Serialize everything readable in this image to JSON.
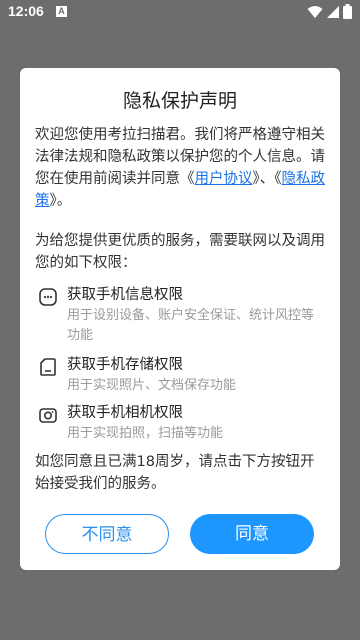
{
  "status_bar": {
    "time": "12:06",
    "notification_badge": "A",
    "icons": [
      "wifi-icon",
      "signal-icon",
      "battery-icon"
    ]
  },
  "dialog": {
    "title": "隐私保护声明",
    "intro_prefix": "欢迎您使用考拉扫描君。我们将严格遵守相关法律法规和隐私政策以保护您的个人信息。请您在使用前阅读并同意《",
    "user_agreement_link": "用户协议",
    "intro_middle": "》、《",
    "privacy_policy_link": "隐私政策",
    "intro_suffix": "》。",
    "permissions_intro": "为给您提供更优质的服务，需要联网以及调用您的如下权限：",
    "permissions": [
      {
        "icon": "phone-info-icon",
        "title": "获取手机信息权限",
        "desc": "用于设别设备、账户安全保证、统计风控等功能"
      },
      {
        "icon": "storage-icon",
        "title": "获取手机存储权限",
        "desc": "用于实现照片、文档保存功能"
      },
      {
        "icon": "camera-icon",
        "title": "获取手机相机权限",
        "desc": "用于实现拍照，扫描等功能"
      }
    ],
    "footer_note": "如您同意且已满18周岁，请点击下方按钮开始接受我们的服务。",
    "disagree_label": "不同意",
    "agree_label": "同意"
  },
  "colors": {
    "accent": "#1e96ff",
    "link": "#1a73e8",
    "overlay": "#6d6d6d"
  }
}
